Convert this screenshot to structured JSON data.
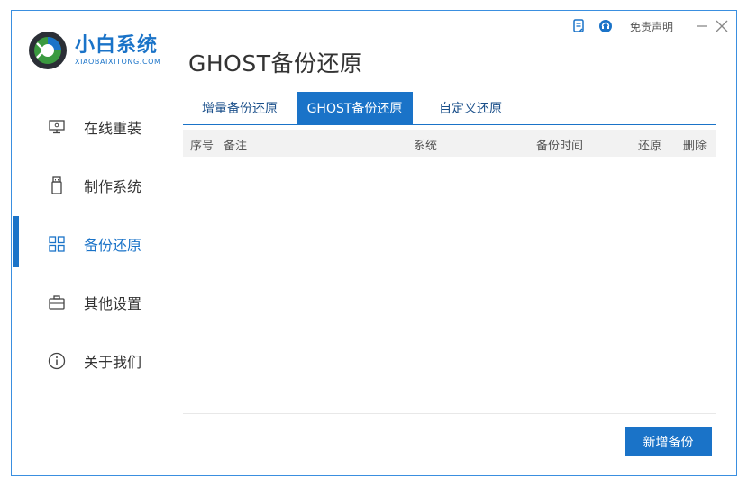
{
  "app": {
    "logo_title": "小白系统",
    "logo_subtitle": "XIAOBAIXITONG.COM",
    "page_title": "GHOST备份还原",
    "accent_color": "#1a73c8"
  },
  "topbar": {
    "icons": [
      "feedback-icon",
      "support-icon"
    ],
    "disclaimer_label": "免责声明",
    "minimize_icon": "minimize-icon",
    "close_icon": "close-icon"
  },
  "sidebar": {
    "items": [
      {
        "label": "在线重装",
        "icon": "monitor-icon",
        "active": false
      },
      {
        "label": "制作系统",
        "icon": "usb-icon",
        "active": false
      },
      {
        "label": "备份还原",
        "icon": "grid-icon",
        "active": true
      },
      {
        "label": "其他设置",
        "icon": "briefcase-icon",
        "active": false
      },
      {
        "label": "关于我们",
        "icon": "info-icon",
        "active": false
      }
    ]
  },
  "tabs": [
    {
      "label": "增量备份还原",
      "active": false
    },
    {
      "label": "GHOST备份还原",
      "active": true
    },
    {
      "label": "自定义还原",
      "active": false
    }
  ],
  "table": {
    "columns": [
      "序号",
      "备注",
      "系统",
      "备份时间",
      "还原",
      "删除"
    ],
    "rows": []
  },
  "actions": {
    "add_backup_label": "新增备份"
  }
}
